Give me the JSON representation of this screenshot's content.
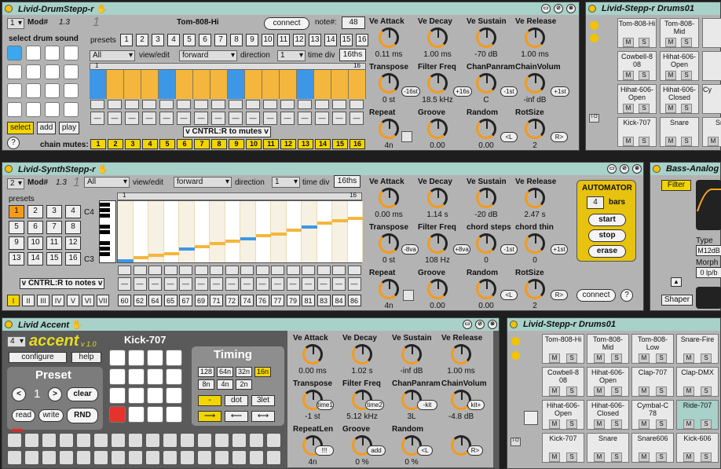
{
  "drum": {
    "title": "Livid-DrumStepp-r",
    "mod_label": "Mod#",
    "mod_value": "1.3",
    "channel": "1",
    "channel_big": "1",
    "drum_name": "Tom-808-Hi",
    "connect": "connect",
    "note_label": "note#:",
    "note_value": "48",
    "select_drum": "select drum sound",
    "presets_label": "presets",
    "presets": [
      "1",
      "2",
      "3",
      "4",
      "5",
      "6",
      "7",
      "8",
      "9",
      "10",
      "11",
      "12",
      "13",
      "14",
      "15",
      "16"
    ],
    "all": "All",
    "view_edit": "view/edit",
    "direction_val": "forward",
    "direction_label": "direction",
    "time_val": "1",
    "time_div": "time div",
    "time_div_val": "16ths",
    "ruler_start": "1",
    "ruler_end": "16",
    "cntrl": "v CNTRL:R to mutes v",
    "select_btn": "select",
    "add_btn": "add",
    "play_btn": "play",
    "help": "?",
    "chain_mutes": "chain mutes:",
    "chain": [
      "1",
      "2",
      "3",
      "4",
      "5",
      "6",
      "7",
      "8",
      "9",
      "10",
      "11",
      "12",
      "13",
      "14",
      "15",
      "16"
    ],
    "steps_blue": [
      0,
      4,
      8,
      12
    ],
    "knobs": [
      {
        "label": "Ve Attack",
        "value": "0.11 ms"
      },
      {
        "label": "Ve Decay",
        "value": "1.00 ms"
      },
      {
        "label": "Ve Sustain",
        "value": "-70 dB"
      },
      {
        "label": "Ve Release",
        "value": "1.00 ms"
      },
      {
        "label": "Transpose",
        "value": "0 st"
      },
      {
        "label": "Filter Freq",
        "value": "18.5 kHz"
      },
      {
        "label": "ChanPanram",
        "value": "C"
      },
      {
        "label": "ChainVolum",
        "value": "-inf dB"
      },
      {
        "label": "Repeat",
        "value": "4n"
      },
      {
        "label": "Groove",
        "value": "0.00"
      },
      {
        "label": "Random",
        "value": "0.00"
      },
      {
        "label": "RotSize",
        "value": "2"
      }
    ],
    "mini": [
      "-16st",
      "+16s",
      "-1st",
      "+1st",
      "<L",
      "R>"
    ]
  },
  "rack1": {
    "title": "Livid-Stepp-r Drums01",
    "cells": [
      "Tom-808-Hi",
      "Tom-808-Mid",
      "Cowbell-8 08",
      "Hihat-606-Open",
      "Hihat-606-Open",
      "Hihat-606-Closed",
      "Kick-707",
      "Snare",
      "Sna"
    ],
    "cy": "Cy",
    "m": "M",
    "s": "S"
  },
  "synth": {
    "title": "Livid-SynthStepp-r",
    "mod_label": "Mod#",
    "mod_value": "1.3",
    "channel": "2",
    "channel_big": "1",
    "all": "All",
    "view_edit": "view/edit",
    "direction_val": "forward",
    "direction_label": "direction",
    "time_val": "1",
    "time_div": "time div",
    "time_div_val": "16ths",
    "presets_label": "presets",
    "presets": [
      "1",
      "2",
      "3",
      "4",
      "5",
      "6",
      "7",
      "8",
      "9",
      "10",
      "11",
      "12",
      "13",
      "14",
      "15",
      "16"
    ],
    "c4": "C4",
    "c3": "C3",
    "ruler_start": "1",
    "ruler_end": "16",
    "cntrl": "v CNTRL:R to notes v",
    "modes": [
      "I",
      "II",
      "III",
      "IV",
      "V",
      "VI",
      "VII"
    ],
    "notes": [
      "60",
      "62",
      "64",
      "65",
      "67",
      "69",
      "71",
      "72",
      "74",
      "76",
      "77",
      "79",
      "81",
      "83",
      "84",
      "86"
    ],
    "knobs": [
      {
        "label": "Ve Attack",
        "value": "0.00 ms"
      },
      {
        "label": "Ve Decay",
        "value": "1.14 s"
      },
      {
        "label": "Ve Sustain",
        "value": "-20 dB"
      },
      {
        "label": "Ve Release",
        "value": "2.47 s"
      },
      {
        "label": "Transpose",
        "value": "0 st"
      },
      {
        "label": "Filter Freq",
        "value": "108 Hz"
      },
      {
        "label": "chord steps",
        "value": "0"
      },
      {
        "label": "chord thin",
        "value": "0"
      },
      {
        "label": "Repeat",
        "value": "4n"
      },
      {
        "label": "Groove",
        "value": "0.00"
      },
      {
        "label": "Random",
        "value": "0.00"
      },
      {
        "label": "RotSize",
        "value": "2"
      }
    ],
    "mini": [
      "-8va",
      "+8va",
      "-1st",
      "+1st",
      "<L",
      "R>"
    ],
    "automator": "AUTOMATOR",
    "bars_val": "4",
    "bars": "bars",
    "start": "start",
    "stop": "stop",
    "erase": "erase",
    "connect": "connect",
    "help": "?"
  },
  "bass": {
    "title": "Bass-Analog",
    "filter": "Filter",
    "type": "Type",
    "type_val": "M12dB",
    "morph": "Morph",
    "morph_val": "0 lp/b",
    "shaper": "Shaper"
  },
  "accent": {
    "title": "Livid Accent",
    "channel": "4",
    "logo": "accent",
    "version": "v 1.0",
    "configure": "configure",
    "help": "help",
    "preset": "Preset",
    "preset_val": "1",
    "clear": "clear",
    "read": "read",
    "write": "write",
    "rnd": "RND",
    "drum": "Kick-707",
    "timing": "Timing",
    "timing_btns": [
      "128",
      "64n",
      "32n",
      "16n",
      "8n",
      "4n",
      "2n"
    ],
    "dash": "-",
    "dot": "dot",
    "trip": "3let",
    "knobs": [
      {
        "label": "Ve Attack",
        "value": "0.00 ms"
      },
      {
        "label": "Ve Decay",
        "value": "1.02 s"
      },
      {
        "label": "Ve Sustain",
        "value": "-inf dB"
      },
      {
        "label": "Ve Release",
        "value": "1.00 ms"
      },
      {
        "label": "Transpose",
        "value": "-1 st"
      },
      {
        "label": "Filter Freq",
        "value": "5.12 kHz"
      },
      {
        "label": "ChanPanram",
        "value": "3L"
      },
      {
        "label": "ChainVolum",
        "value": "-4.8 dB"
      },
      {
        "label": "RepeatLen",
        "value": "4n"
      },
      {
        "label": "Groove",
        "value": "0 %"
      },
      {
        "label": "Random",
        "value": "0 %"
      },
      {
        "label": "",
        "value": ""
      }
    ],
    "mini": [
      "time1",
      "time2",
      "-kit",
      "kit+",
      "!!!",
      "add",
      "<L",
      "R>"
    ],
    "mini_dash": "-"
  },
  "rack2": {
    "title": "Livid-Stepp-r Drums01",
    "cells": [
      "Tom-808-Hi",
      "Tom-808-Mid",
      "Tom-808-Low",
      "Snare-Fire",
      "Cowbell-8 08",
      "Hihat-606-Open",
      "Clap-707",
      "Clap-DMX",
      "Hihat-606-Open",
      "Hihat-606-Closed",
      "Cymbal-C 78",
      "Ride-707",
      "Kick-707",
      "Snare",
      "Snare606",
      "Kick-606"
    ],
    "m": "M",
    "s": "S"
  }
}
